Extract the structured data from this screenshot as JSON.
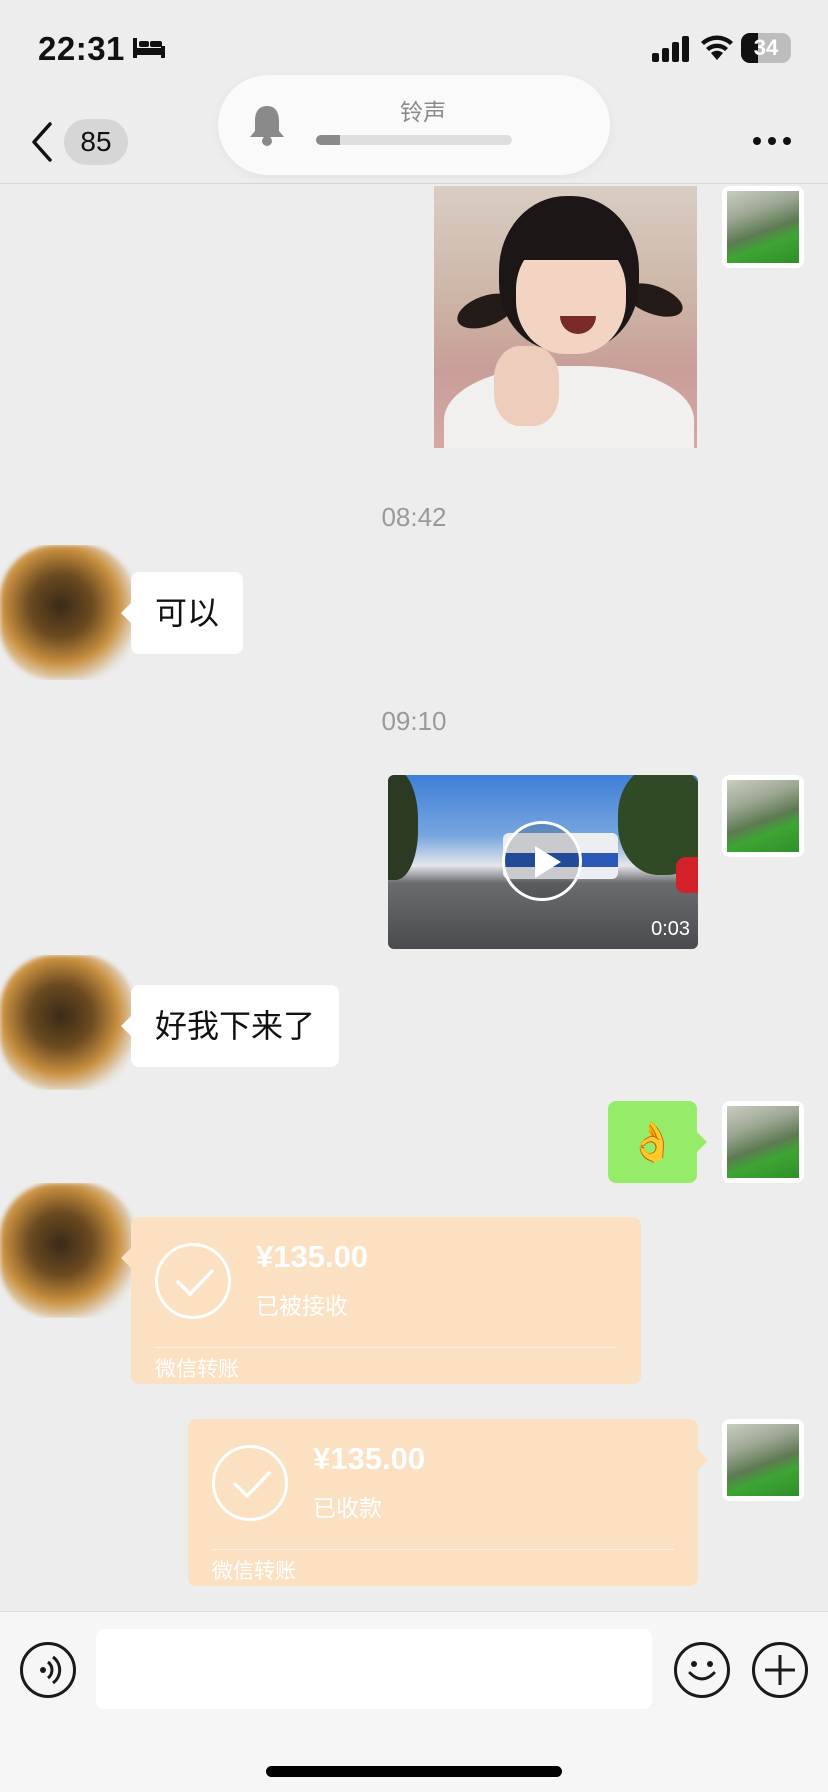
{
  "status_bar": {
    "time": "22:31",
    "battery": "34",
    "battery_level": 0.34,
    "icons": [
      "bed-icon",
      "cellular-signal-icon",
      "wifi-icon",
      "battery-icon"
    ]
  },
  "nav": {
    "unread_count": "85",
    "icons": [
      "back-chevron-icon",
      "more-icon"
    ]
  },
  "ringtone_hud": {
    "label": "铃声",
    "level": 0.12,
    "icon": "bell-icon"
  },
  "messages": {
    "timestamp_1": "08:42",
    "msg_1": "可以",
    "timestamp_2": "09:10",
    "video_duration": "0:03",
    "msg_2": "好我下来了",
    "msg_3": "👌",
    "transfer_1": {
      "amount": "¥135.00",
      "status": "已被接收",
      "footer": "微信转账"
    },
    "transfer_2": {
      "amount": "¥135.00",
      "status": "已收款",
      "footer": "微信转账"
    }
  },
  "input_bar": {
    "icons": [
      "voice-icon",
      "emoji-icon",
      "plus-icon"
    ]
  },
  "colors": {
    "background": "#ededed",
    "self_bubble": "#95ec69",
    "transfer_card": "#fbe0c2"
  }
}
